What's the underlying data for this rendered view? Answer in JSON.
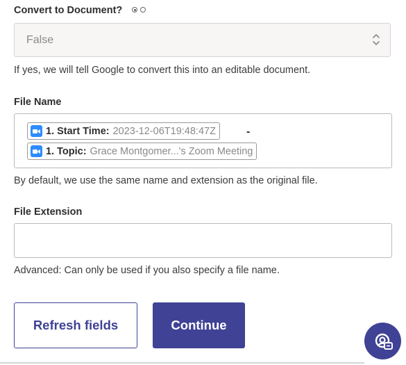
{
  "convert": {
    "label": "Convert to Document?",
    "value": "False",
    "help": "If yes, we will tell Google to convert this into an editable document."
  },
  "file_name": {
    "label": "File Name",
    "tokens": [
      {
        "label": "1. Start Time:",
        "value": "2023-12-06T19:48:47Z",
        "icon": "zoom-icon"
      },
      {
        "label": "1. Topic:",
        "value": "Grace Montgomer...'s Zoom Meeting",
        "icon": "zoom-icon"
      }
    ],
    "separator": "-",
    "help": "By default, we use the same name and extension as the original file."
  },
  "file_extension": {
    "label": "File Extension",
    "value": "",
    "placeholder": "",
    "help": "Advanced: Can only be used if you also specify a file name."
  },
  "buttons": {
    "refresh": "Refresh fields",
    "continue": "Continue"
  },
  "colors": {
    "accent": "#3f4295",
    "zoom": "#2d8cff"
  }
}
